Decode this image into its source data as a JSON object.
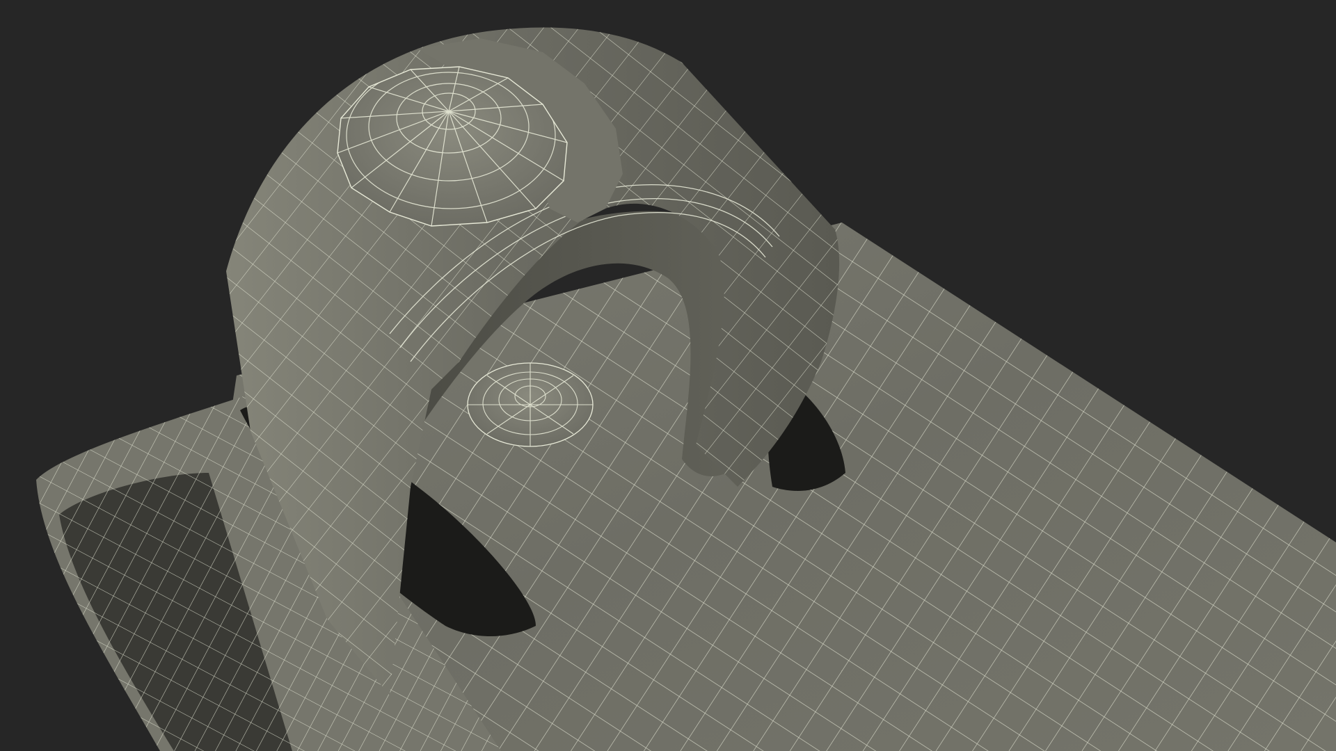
{
  "scene": {
    "background": "#262626",
    "mesh_fill": "#6f6f66",
    "mesh_fill_light": "#7c7c72",
    "mesh_fill_dark": "#55554d",
    "cavity": "#1b1b19",
    "wire": "#e8ead8"
  }
}
